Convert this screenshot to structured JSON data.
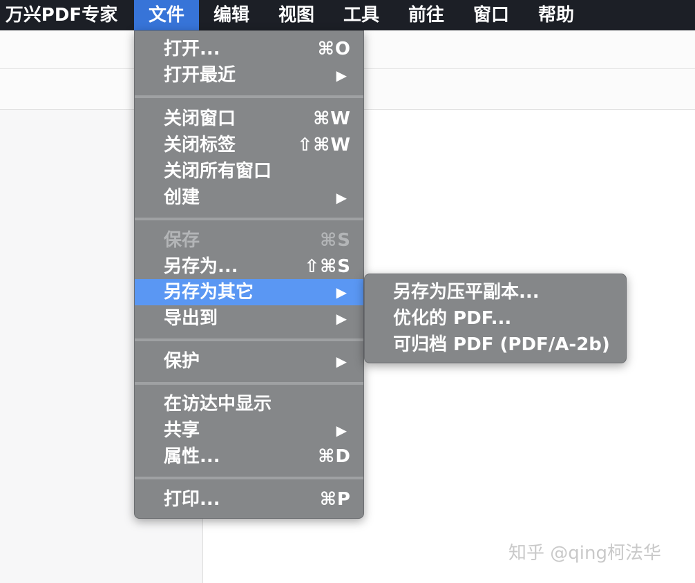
{
  "menubar": {
    "app_name": "万兴PDF专家",
    "menus": [
      "文件",
      "编辑",
      "视图",
      "工具",
      "前往",
      "窗口",
      "帮助"
    ],
    "active_menu": "文件"
  },
  "file_menu": {
    "items": [
      {
        "label": "打开...",
        "shortcut": "⌘O"
      },
      {
        "label": "打开最近",
        "submenu_arrow": "▶"
      },
      {
        "label": "关闭窗口",
        "shortcut": "⌘W"
      },
      {
        "label": "关闭标签",
        "shortcut": "⇧⌘W"
      },
      {
        "label": "关闭所有窗口"
      },
      {
        "label": "创建",
        "submenu_arrow": "▶"
      },
      {
        "label": "保存",
        "shortcut": "⌘S",
        "disabled": true
      },
      {
        "label": "另存为...",
        "shortcut": "⇧⌘S"
      },
      {
        "label": "另存为其它",
        "submenu_arrow": "▶",
        "highlighted": true
      },
      {
        "label": "导出到",
        "submenu_arrow": "▶"
      },
      {
        "label": "保护",
        "submenu_arrow": "▶"
      },
      {
        "label": "在访达中显示"
      },
      {
        "label": "共享",
        "submenu_arrow": "▶"
      },
      {
        "label": "属性...",
        "shortcut": "⌘D"
      },
      {
        "label": "打印...",
        "shortcut": "⌘P"
      }
    ]
  },
  "save_as_other_submenu": {
    "items": [
      {
        "label": "另存为压平副本..."
      },
      {
        "label": "优化的 PDF..."
      },
      {
        "label": "可归档 PDF (PDF/A-2b)"
      }
    ]
  },
  "watermark": "知乎 @qing柯法华",
  "colors": {
    "menubar_bg": "#1c1f26",
    "active_menu_bg": "#3774d8",
    "menu_bg": "#858789",
    "highlight_bg": "#5a97f3",
    "disabled_text": "#b3b5b7"
  }
}
